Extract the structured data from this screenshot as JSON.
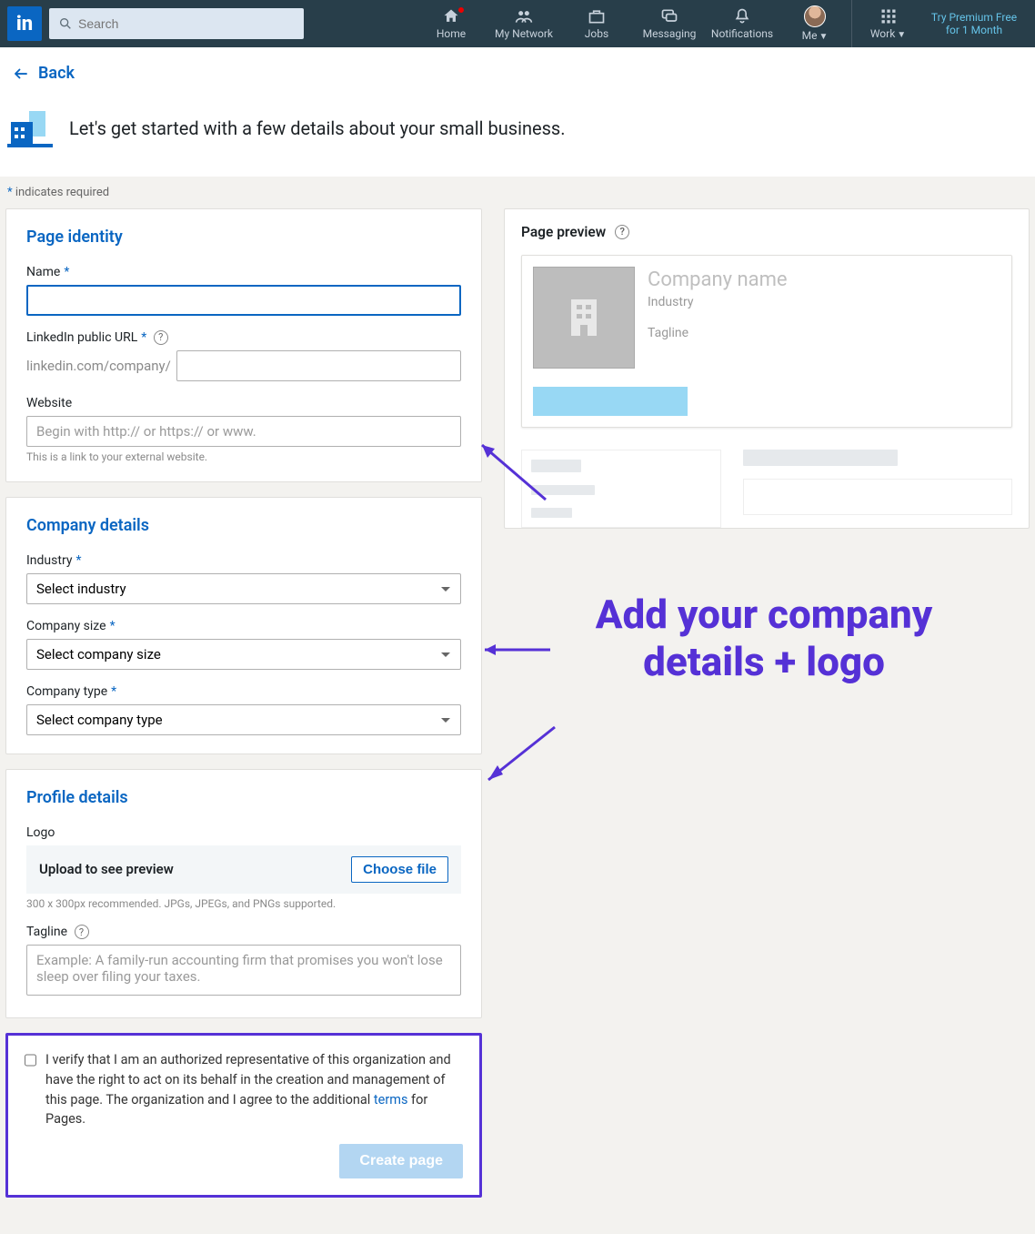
{
  "nav": {
    "logo": "in",
    "search_placeholder": "Search",
    "items": {
      "home": "Home",
      "network": "My Network",
      "jobs": "Jobs",
      "messaging": "Messaging",
      "notifications": "Notifications",
      "me": "Me",
      "work": "Work"
    },
    "premium": "Try Premium Free for 1 Month"
  },
  "back_label": "Back",
  "intro": "Let's get started with a few details about your small business.",
  "required_note": "indicates required",
  "sections": {
    "identity": {
      "title": "Page identity",
      "name_label": "Name",
      "url_label": "LinkedIn public URL",
      "url_prefix": "linkedin.com/company/",
      "website_label": "Website",
      "website_placeholder": "Begin with http:// or https:// or www.",
      "website_helper": "This is a link to your external website."
    },
    "company": {
      "title": "Company details",
      "industry_label": "Industry",
      "industry_placeholder": "Select industry",
      "size_label": "Company size",
      "size_placeholder": "Select company size",
      "type_label": "Company type",
      "type_placeholder": "Select company type"
    },
    "profile": {
      "title": "Profile details",
      "logo_label": "Logo",
      "upload_label": "Upload to see preview",
      "choose_file": "Choose file",
      "logo_helper": "300 x 300px recommended. JPGs, JPEGs, and PNGs supported.",
      "tagline_label": "Tagline",
      "tagline_placeholder": "Example: A family-run accounting firm that promises you won't lose sleep over filing your taxes."
    },
    "verify": {
      "text_pre": "I verify that I am an authorized representative of this organization and have the right to act on its behalf in the creation and management of this page. The organization and I agree to the additional ",
      "terms": "terms",
      "text_post": " for Pages.",
      "create": "Create page"
    }
  },
  "preview": {
    "title": "Page preview",
    "company_name": "Company name",
    "industry": "Industry",
    "tagline": "Tagline"
  },
  "annotation": "Add your company details + logo"
}
